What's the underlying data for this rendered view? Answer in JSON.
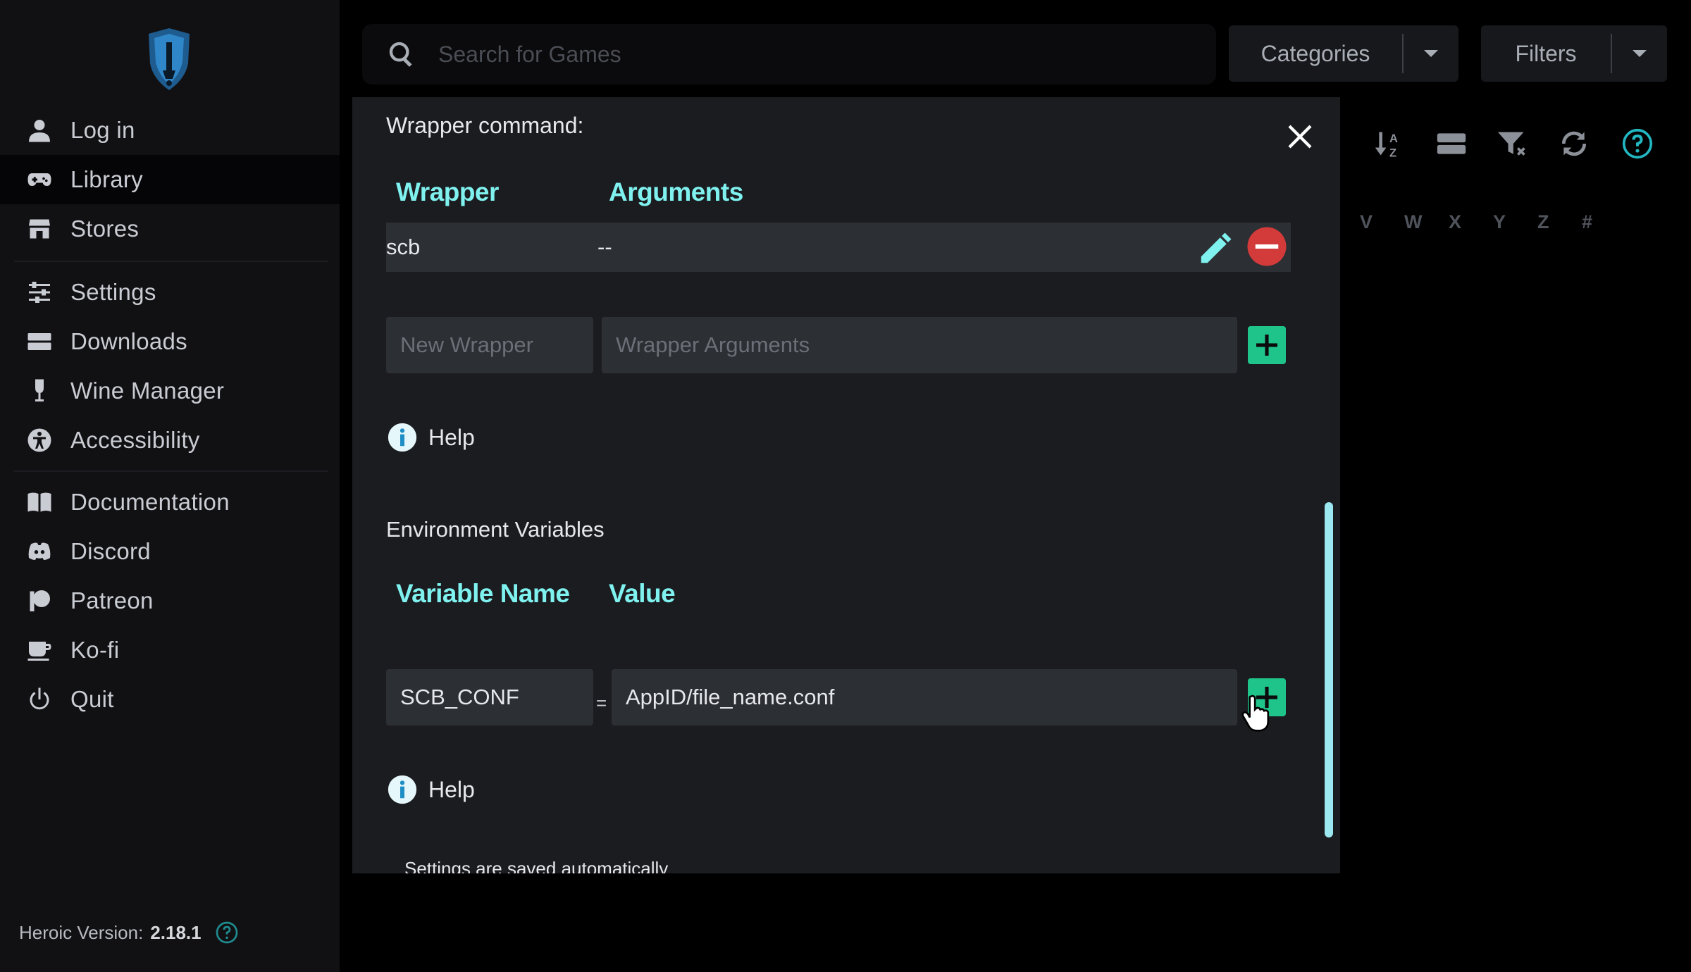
{
  "sidebar": {
    "items": [
      {
        "label": "Log in",
        "icon": "user-icon"
      },
      {
        "label": "Library",
        "icon": "gamepad-icon"
      },
      {
        "label": "Stores",
        "icon": "store-icon"
      },
      {
        "label": "Settings",
        "icon": "sliders-icon"
      },
      {
        "label": "Downloads",
        "icon": "downloads-icon"
      },
      {
        "label": "Wine Manager",
        "icon": "wine-icon"
      },
      {
        "label": "Accessibility",
        "icon": "accessibility-icon"
      },
      {
        "label": "Documentation",
        "icon": "book-icon"
      },
      {
        "label": "Discord",
        "icon": "discord-icon"
      },
      {
        "label": "Patreon",
        "icon": "patreon-icon"
      },
      {
        "label": "Ko-fi",
        "icon": "coffee-icon"
      },
      {
        "label": "Quit",
        "icon": "power-icon"
      }
    ],
    "active": "Library",
    "version_label": "Heroic Version:",
    "version_number": "2.18.1"
  },
  "topbar": {
    "search_placeholder": "Search for Games",
    "categories_label": "Categories",
    "filters_label": "Filters"
  },
  "alphabet": [
    "V",
    "W",
    "X",
    "Y",
    "Z",
    "#"
  ],
  "dialog": {
    "wrapper_heading": "Wrapper command:",
    "wrapper_columns": {
      "wrapper": "Wrapper",
      "arguments": "Arguments"
    },
    "wrapper_rows": [
      {
        "wrapper": "scb",
        "arguments": "--"
      }
    ],
    "new_wrapper_placeholder": "New Wrapper",
    "wrapper_args_placeholder": "Wrapper Arguments",
    "help_label": "Help",
    "env_heading": "Environment Variables",
    "env_columns": {
      "name": "Variable Name",
      "value": "Value"
    },
    "env_name_value": "SCB_CONF",
    "env_value_value": "AppID/file_name.conf",
    "equals": "=",
    "saved_note": "Settings are saved automatically"
  },
  "colors": {
    "accent_cyan": "#7ff2ef",
    "add_green": "#1fc48a",
    "remove_red": "#d33b3b",
    "sidebar_bg": "#111114",
    "dialog_bg": "#1b1c20"
  }
}
